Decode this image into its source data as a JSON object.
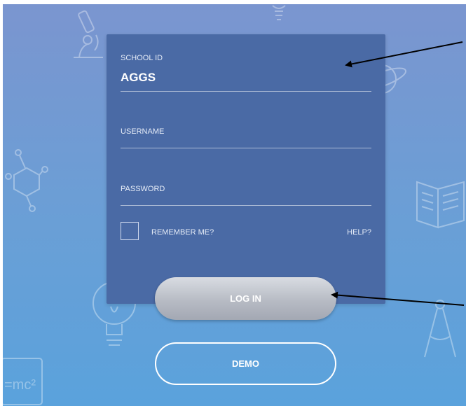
{
  "form": {
    "school_id_label": "SCHOOL ID",
    "school_id_value": "AGGS",
    "username_label": "USERNAME",
    "username_value": "",
    "password_label": "PASSWORD",
    "password_value": "",
    "remember_label": "REMEMBER ME?",
    "remember_checked": false,
    "help_label": "HELP?"
  },
  "buttons": {
    "login_label": "LOG IN",
    "demo_label": "DEMO"
  },
  "decorations": {
    "icons": [
      "microscope-icon",
      "lightbulb-icon",
      "planet-icon",
      "molecule-icon",
      "book-icon",
      "compass-icon",
      "emc2-board-icon"
    ],
    "formula_text": "=mc²"
  },
  "colors": {
    "card": "#4a6aa5",
    "background_top": "#7b95cf",
    "background_bottom": "#5aa2dc",
    "login_button": "#b7bbc4",
    "annotation_arrow": "#000000"
  }
}
